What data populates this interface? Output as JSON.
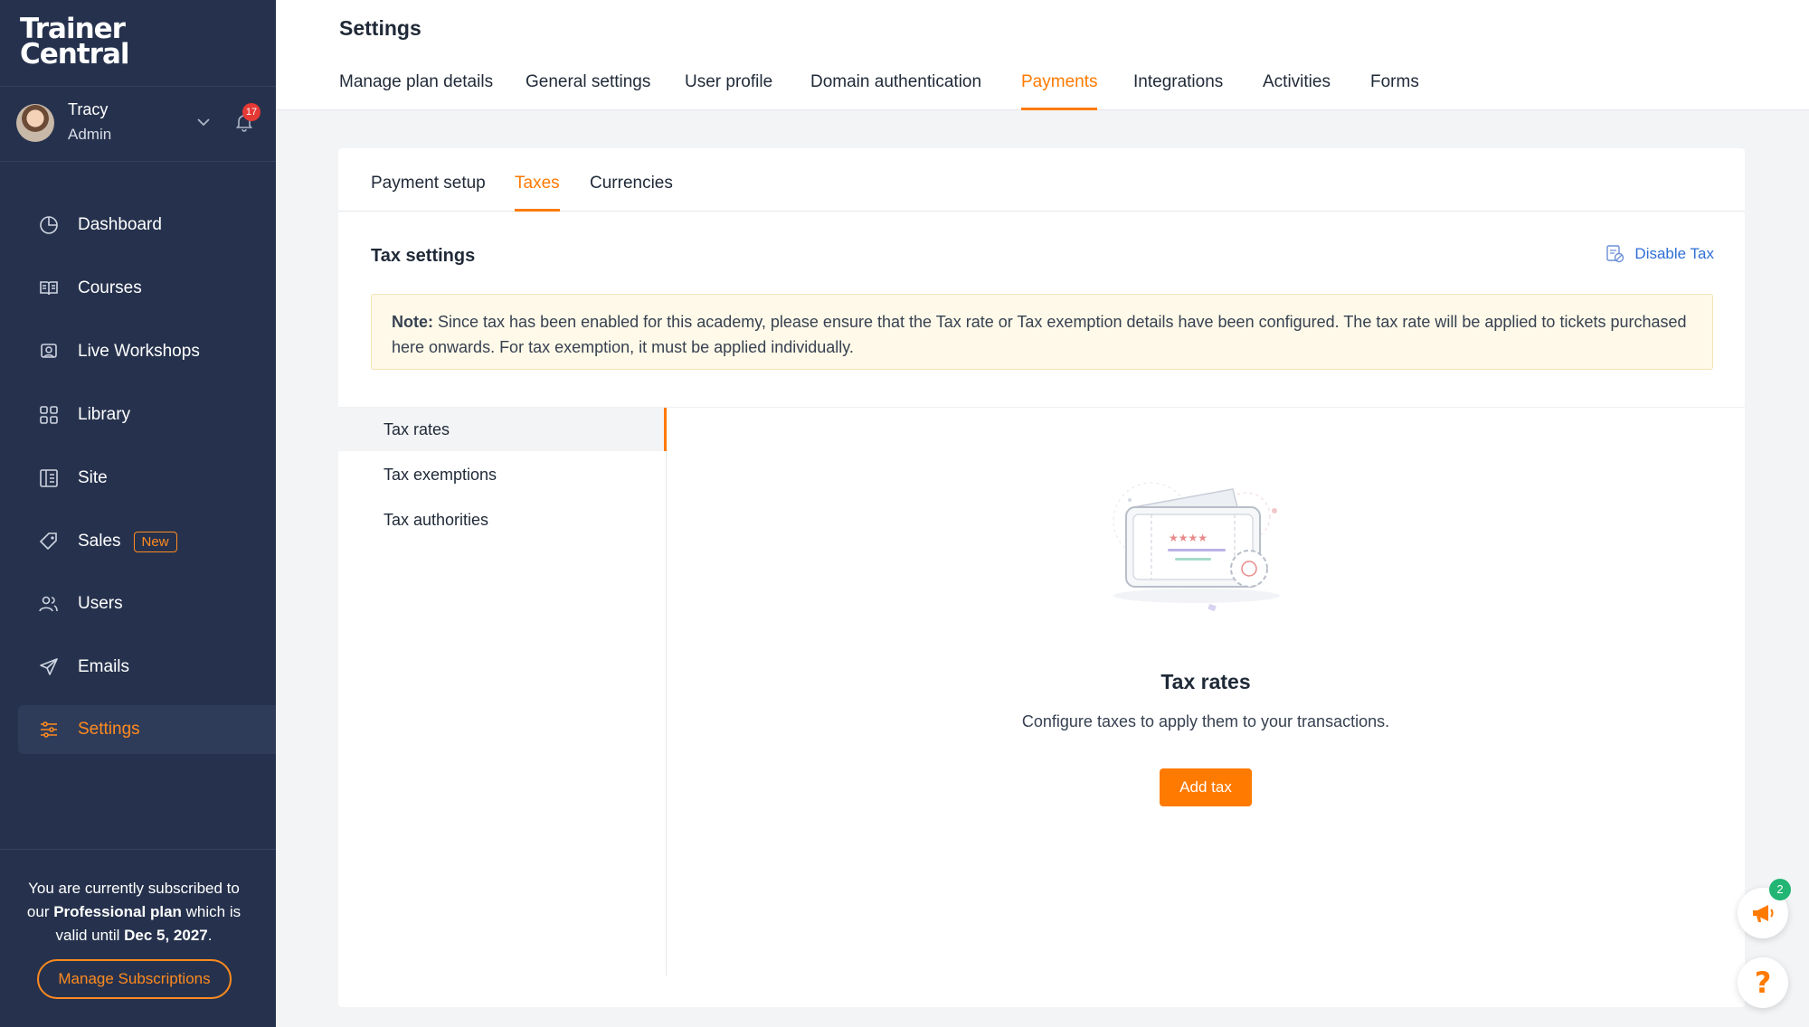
{
  "brand": {
    "logo_line1": "Trainer",
    "logo_line2": "Central"
  },
  "user": {
    "name": "Tracy",
    "role": "Admin",
    "notification_count": "17"
  },
  "nav": {
    "items": [
      {
        "label": "Dashboard",
        "icon": "dashboard-icon"
      },
      {
        "label": "Courses",
        "icon": "courses-icon"
      },
      {
        "label": "Live Workshops",
        "icon": "workshops-icon"
      },
      {
        "label": "Library",
        "icon": "library-icon"
      },
      {
        "label": "Site",
        "icon": "site-icon"
      },
      {
        "label": "Sales",
        "icon": "sales-icon",
        "badge": "New"
      },
      {
        "label": "Users",
        "icon": "users-icon"
      },
      {
        "label": "Emails",
        "icon": "emails-icon"
      },
      {
        "label": "Settings",
        "icon": "settings-icon",
        "active": true
      }
    ]
  },
  "subscription": {
    "line1": "You are currently subscribed to",
    "line2_prefix": "our ",
    "plan": "Professional plan",
    "line2_suffix": " which is",
    "line3_prefix": "valid until ",
    "date": "Dec 5, 2027",
    "line3_suffix": ".",
    "manage_label": "Manage Subscriptions"
  },
  "header": {
    "title": "Settings",
    "tabs": [
      {
        "label": "Manage plan details"
      },
      {
        "label": "General settings"
      },
      {
        "label": "User profile"
      },
      {
        "label": "Domain authentication"
      },
      {
        "label": "Payments",
        "active": true
      },
      {
        "label": "Integrations"
      },
      {
        "label": "Activities"
      },
      {
        "label": "Forms"
      }
    ]
  },
  "payments": {
    "tabs": [
      {
        "label": "Payment setup"
      },
      {
        "label": "Taxes",
        "active": true
      },
      {
        "label": "Currencies"
      }
    ],
    "tax_settings_title": "Tax settings",
    "disable_tax_label": "Disable Tax",
    "note_label": "Note:",
    "note_text": " Since tax has been enabled for this academy, please ensure that the Tax rate or Tax exemption details have been configured. The tax rate will be applied to tickets purchased here onwards. For tax exemption, it must be applied individually.",
    "side_items": [
      {
        "label": "Tax rates",
        "active": true
      },
      {
        "label": "Tax exemptions"
      },
      {
        "label": "Tax authorities"
      }
    ],
    "empty_title": "Tax rates",
    "empty_desc": "Configure taxes to apply them to your transactions.",
    "add_tax_label": "Add tax"
  },
  "floating": {
    "announcements_count": "2",
    "help_glyph": "?"
  },
  "colors": {
    "sidebar_bg": "#26324d",
    "accent": "#ff7a00",
    "link": "#2f6fd6"
  }
}
